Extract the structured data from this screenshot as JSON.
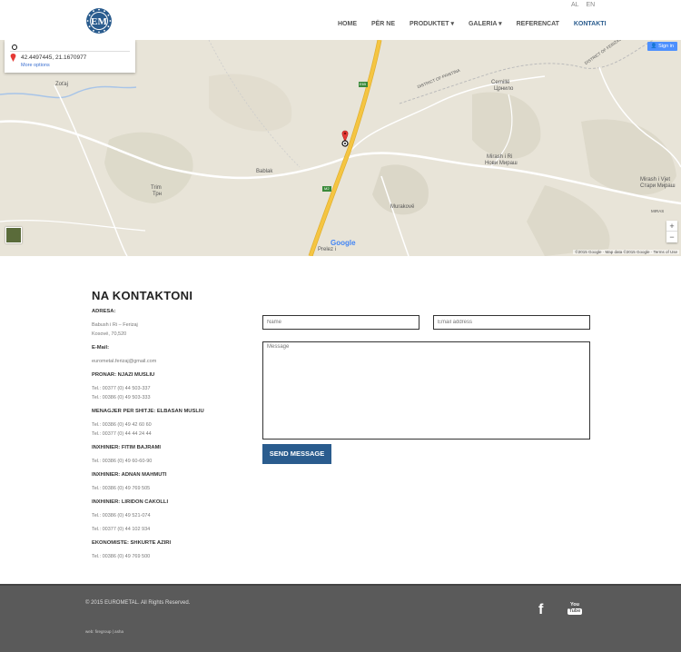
{
  "header": {
    "lang": [
      "AL",
      "EN"
    ],
    "nav": [
      "HOME",
      "PËR NE",
      "PRODUKTET ▾",
      "GALERIA ▾",
      "REFERENCAT",
      "KONTAKTI"
    ],
    "active_nav": "KONTAKTI",
    "logo_text": "EM"
  },
  "map": {
    "infobox_coords": "42.4497445, 21.1670977",
    "infobox_more": "More options",
    "signin": "Sign in",
    "zoom_in": "+",
    "zoom_out": "−",
    "google": "Google",
    "copyright": "©2015 Google · Map data ©2015 Google · Terms of Use",
    "labels": {
      "zotaj": "Zoťaj",
      "bablak": "Bablak",
      "trim": "Trim",
      "trim_cyr": "Трн",
      "cernille": "Cernillë",
      "cernille_cyr": "Црнило",
      "mirash": "Mirash i Ri",
      "mirash_cyr": "Нови Мираш",
      "mirash2": "Mirash i Vjet",
      "mirash2_cyr": "Стари Мираш",
      "murakove": "Murakovë",
      "prelez": "Prelez i",
      "district_pristina": "DISTRICT OF PRISTINA",
      "district_ferizaj": "DISTRICT OF FERIZAJ",
      "road_e65": "E65",
      "road_m2": "M2",
      "miras": "MIRAS"
    }
  },
  "contact": {
    "title": "NA KONTAKTONI",
    "address_label": "ADRESA:",
    "address_line1": "Babush i Ri – Ferizaj",
    "address_line2": "Kosovë, 70,520",
    "email_label": "E-Mail:",
    "email": "eurometal.ferizaj@gmail.com",
    "owner_label": "PRONAR: NJAZI MUSLIU",
    "owner_tel1": "Tel.: 00377 (0) 44 503-337",
    "owner_tel2": "Tel.: 00386 (0) 49 503-333",
    "manager_label": "MENAGJER PER SHITJE: ELBASAN MUSLIU",
    "manager_tel1": "Tel.: 00386 (0) 49 42 60 60",
    "manager_tel2": "Tel.: 00377 (0) 44 44 24 44",
    "eng1_label": "INXHINIER: FITIM BAJRAMI",
    "eng1_tel": "Tel.: 00386 (0) 49 60-60-90",
    "eng2_label": "INXHINIER: ADNAN MAHMUTI",
    "eng2_tel": "Tel.: 00386 (0) 49 769 505",
    "eng3_label": "INXHINIER: LIRIDON CAKOLLI",
    "eng3_tel1": "Tel.: 00386 (0) 49 521-074",
    "eng3_tel2": "Tel.: 00377 (0) 44 102 934",
    "econ_label": "EKONOMISTE: SHKURTE AZIRI",
    "econ_tel": "Tel.: 00386 (0) 49 769 500",
    "name_placeholder": "Name",
    "email_placeholder": "Email address",
    "message_placeholder": "Message",
    "send_label": "SEND MESSAGE"
  },
  "footer": {
    "copyright": "© 2015 EUROMETAL. All Rights Reserved.",
    "webby": "web: firegroup | asha",
    "youtube_top": "You",
    "youtube_bottom": "Tube"
  },
  "colors": {
    "accent": "#2a5c8e",
    "footer_bg": "#5a5a5a",
    "map_bg": "#e8e4d8",
    "highway": "#f5c542"
  }
}
